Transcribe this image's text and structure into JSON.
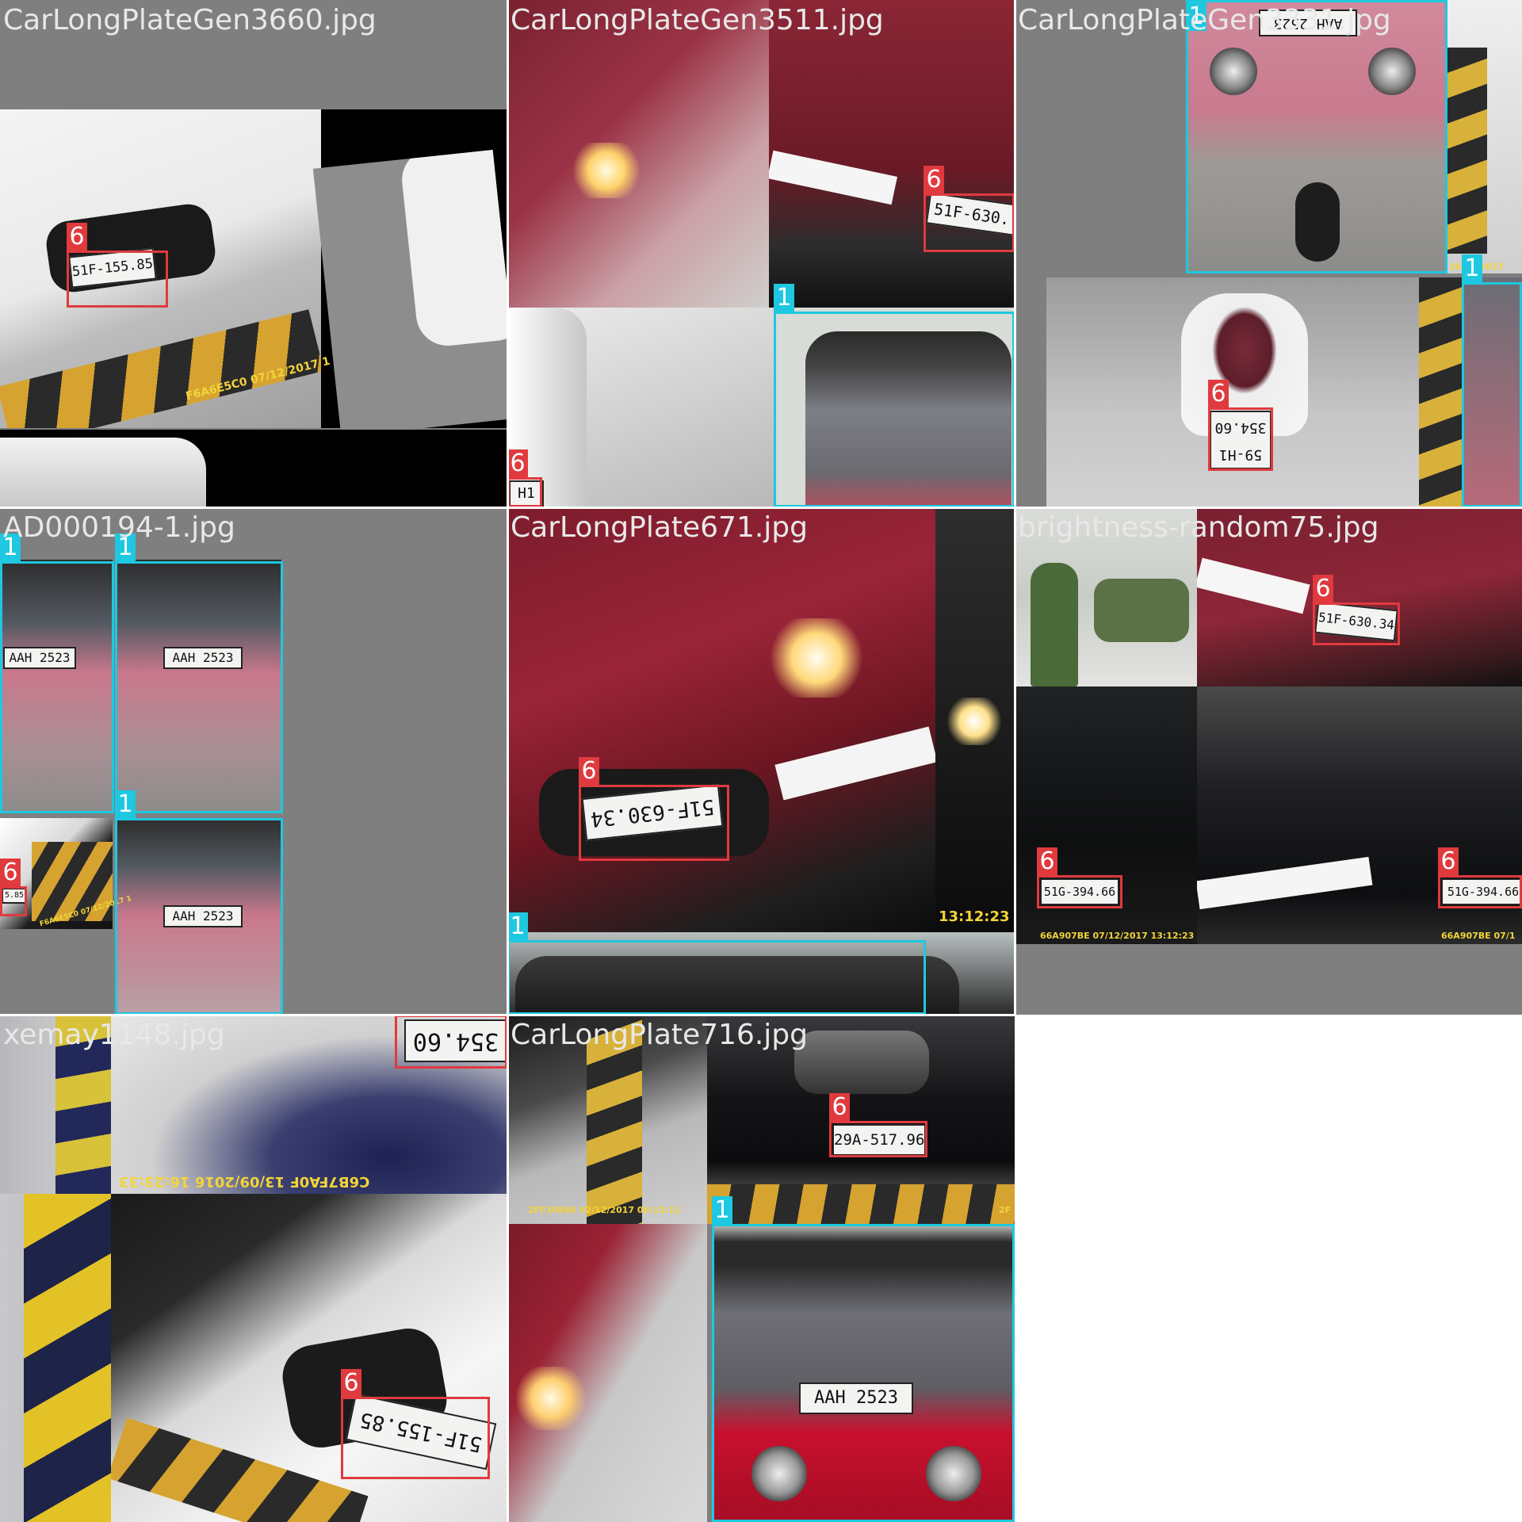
{
  "mosaic": {
    "tiles": [
      {
        "title": "CarLongPlateGen3660.jpg",
        "labels": [
          "6"
        ],
        "plates": [
          "51F-155.85"
        ],
        "stamps": [
          "F6A6E5C0  07/12/2017 1"
        ]
      },
      {
        "title": "CarLongPlateGen3511.jpg",
        "labels": [
          "6",
          "1",
          "6"
        ],
        "plates": [
          "51F-630.",
          "H1"
        ]
      },
      {
        "title": "CarLongPlateGen3331.jpg",
        "labels": [
          "1",
          "6",
          "1"
        ],
        "plates": [
          "59-H1 354.60",
          "AAH 2523"
        ],
        "stamps": [
          "26/01/2017"
        ]
      },
      {
        "title": "AD000194-1.jpg",
        "labels": [
          "1",
          "1",
          "1",
          "6"
        ],
        "plates": [
          "AAH 2523",
          "AAH 2523",
          "AAH 2523",
          "5.85"
        ],
        "stamps": [
          "F6A6E5C0  07/12/2017 1"
        ]
      },
      {
        "title": "CarLongPlate671.jpg",
        "labels": [
          "6",
          "1"
        ],
        "plates": [
          "51F-630.34"
        ],
        "stamps": [
          "13:12:23"
        ]
      },
      {
        "title": "brightness-random75.jpg",
        "labels": [
          "6",
          "6",
          "6"
        ],
        "plates": [
          "51F-630.34",
          "51G-394.66",
          "51G-394.66"
        ],
        "stamps": [
          "66A907BE  07/12/2017  13:12:23",
          "66A907BE  07/1"
        ]
      },
      {
        "title": "xemay1148.jpg",
        "labels": [
          "6",
          "6"
        ],
        "plates": [
          "354.60",
          "51F-155.85"
        ],
        "stamps": [
          "C6B7FA0F  13/09/2016  16:23:33"
        ]
      },
      {
        "title": "CarLongPlate716.jpg",
        "labels": [
          "6",
          "1"
        ],
        "plates": [
          "29A-517.96",
          "AAH 2523"
        ],
        "stamps": [
          "2FF30840  02/12/2017  06:13:11",
          "2F"
        ]
      }
    ]
  },
  "colors": {
    "class_6": "#e03a3e",
    "class_1": "#1ec8e0",
    "canvas_gray": "#7f7f7f"
  }
}
